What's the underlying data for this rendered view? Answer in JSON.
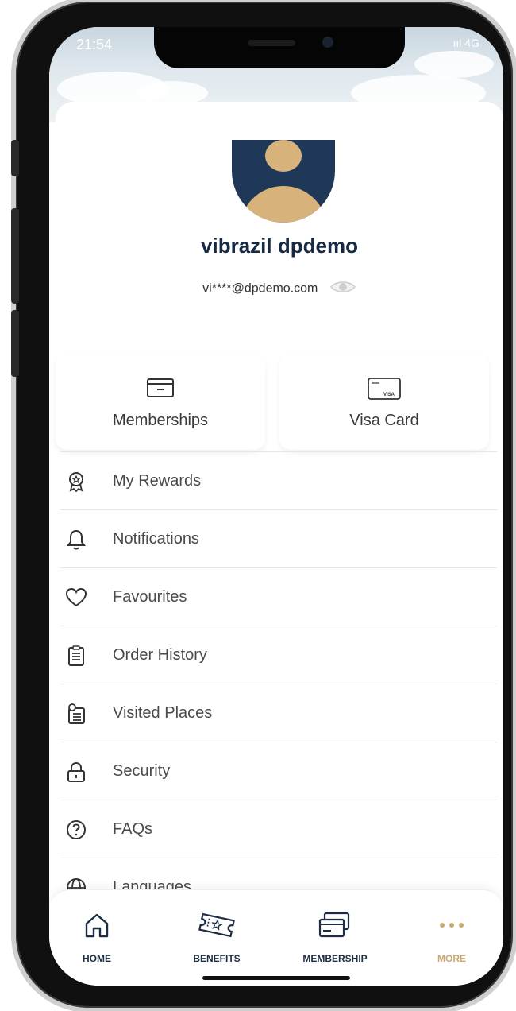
{
  "status_bar": {
    "time": "21:54",
    "signal": "ııl 4G"
  },
  "profile": {
    "name": "vibrazil dpdemo",
    "email_masked": "vi****@dpdemo.com"
  },
  "tiles": [
    {
      "label": "Memberships",
      "icon": "membership-card-icon"
    },
    {
      "label": "Visa Card",
      "icon": "visa-card-icon",
      "badge": "VISA"
    }
  ],
  "menu": [
    {
      "label": "My Rewards",
      "icon": "reward-badge-icon"
    },
    {
      "label": "Notifications",
      "icon": "bell-icon"
    },
    {
      "label": "Favourites",
      "icon": "heart-icon"
    },
    {
      "label": "Order History",
      "icon": "clipboard-list-icon"
    },
    {
      "label": "Visited Places",
      "icon": "place-list-icon"
    },
    {
      "label": "Security",
      "icon": "lock-icon"
    },
    {
      "label": "FAQs",
      "icon": "question-circle-icon"
    },
    {
      "label": "Languages",
      "icon": "globe-icon"
    }
  ],
  "tabbar": {
    "items": [
      {
        "label": "HOME",
        "icon": "home-icon"
      },
      {
        "label": "BENEFITS",
        "icon": "ticket-icon"
      },
      {
        "label": "MEMBERSHIP",
        "icon": "cards-icon"
      },
      {
        "label": "MORE",
        "icon": "dots-icon"
      }
    ],
    "active": "MORE"
  },
  "colors": {
    "brand_navy": "#172a45",
    "accent_gold": "#c9a96e",
    "avatar_bg": "#1f3857",
    "avatar_figure": "#d8b27b"
  }
}
